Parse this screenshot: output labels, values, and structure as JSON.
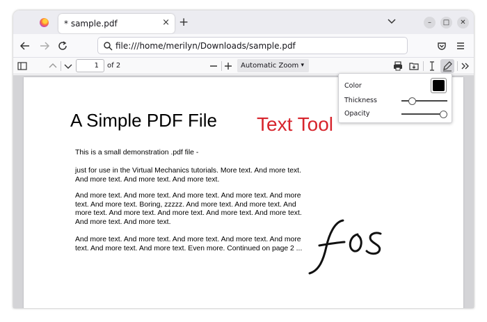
{
  "tab": {
    "title": "* sample.pdf",
    "close": "×",
    "new": "+"
  },
  "nav": {
    "url": "file:///home/merilyn/Downloads/sample.pdf"
  },
  "toolbar": {
    "page_current": "1",
    "page_count": "of 2",
    "zoom": "Automatic Zoom"
  },
  "document": {
    "title": "A Simple PDF File",
    "paragraphs": [
      "This is a small demonstration .pdf file -",
      "just for use in the Virtual Mechanics tutorials. More text. And more text. And more text. And more text. And more text.",
      "And more text. And more text. And more text. And more text. And more text. And more text. Boring, zzzzz. And more text. And more text. And more text. And more text. And more text. And more text. And more text. And more text. And more text.",
      "And more text. And more text. And more text. And more text. And more text. And more text. And more text. Even more. Continued on page 2 ..."
    ],
    "annotation_text": "Text Tool",
    "annotation_color": "#d7242c"
  },
  "editor_params": {
    "color_label": "Color",
    "thickness_label": "Thickness",
    "opacity_label": "Opacity",
    "color": "#000000",
    "thickness_value": 0.22,
    "opacity_value": 1.0
  },
  "icons": [
    "firefox-logo-icon",
    "tab-close-icon",
    "new-tab-icon",
    "list-all-tabs-icon",
    "minimize-icon",
    "maximize-icon",
    "close-window-icon",
    "back-icon",
    "forward-icon",
    "reload-icon",
    "search-icon",
    "pocket-icon",
    "menu-icon",
    "sidebar-toggle-icon",
    "previous-page-icon",
    "next-page-icon",
    "zoom-out-icon",
    "zoom-in-icon",
    "print-icon",
    "download-icon",
    "text-editor-icon",
    "ink-editor-icon",
    "more-tools-icon"
  ]
}
